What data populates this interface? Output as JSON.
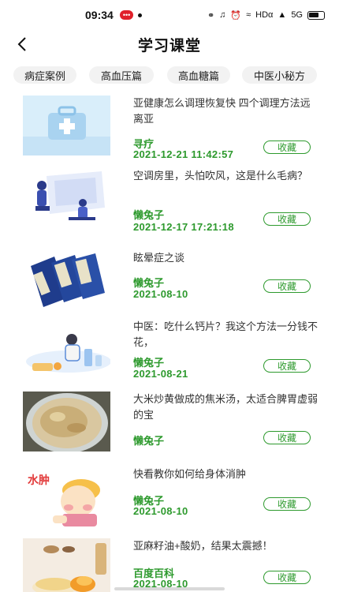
{
  "status": {
    "time": "09:34",
    "badge": "•••",
    "network": "HDα",
    "signal": "5G"
  },
  "header": {
    "title": "学习课堂"
  },
  "tabs": [
    {
      "label": "病症案例",
      "active": true
    },
    {
      "label": "高血压篇",
      "active": false
    },
    {
      "label": "高血糖篇",
      "active": false
    },
    {
      "label": "中医小秘方",
      "active": false
    }
  ],
  "articles": [
    {
      "title": "亚健康怎么调理恢复快 四个调理方法远离亚",
      "author": "寻疗",
      "date": "2021-12-21 11:42:57",
      "fav": "收藏",
      "image": "medical-kit-illustration"
    },
    {
      "title": "空调房里，头怕吹风，这是什么毛病？",
      "author": "懒兔子",
      "date": "2021-12-17 17:21:18",
      "fav": "收藏",
      "image": "doctor-consultation-illustration"
    },
    {
      "title": "眩晕症之谈",
      "author": "懒兔子",
      "date": "2021-08-10",
      "fav": "收藏",
      "image": "medical-books-photo"
    },
    {
      "title": "中医：吃什么钙片？我这个方法一分钱不花，",
      "author": "懒兔子",
      "date": "2021-08-21",
      "fav": "收藏",
      "image": "calcium-illustration"
    },
    {
      "title": "大米炒黄做成的焦米汤，太适合脾胃虚弱的宝",
      "author": "懒兔子",
      "date": "",
      "fav": "收藏",
      "image": "toasted-rice-photo"
    },
    {
      "title": "快看教你如何给身体消肿",
      "author": "懒兔子",
      "date": "2021-08-10",
      "fav": "收藏",
      "image": "swelling-cartoon",
      "image_text": "水肿"
    },
    {
      "title": "亚麻籽油+酸奶，结果太震撼！",
      "author": "百度百科",
      "date": "2021-08-10",
      "fav": "收藏",
      "image": "flaxseed-oil-photo"
    }
  ]
}
